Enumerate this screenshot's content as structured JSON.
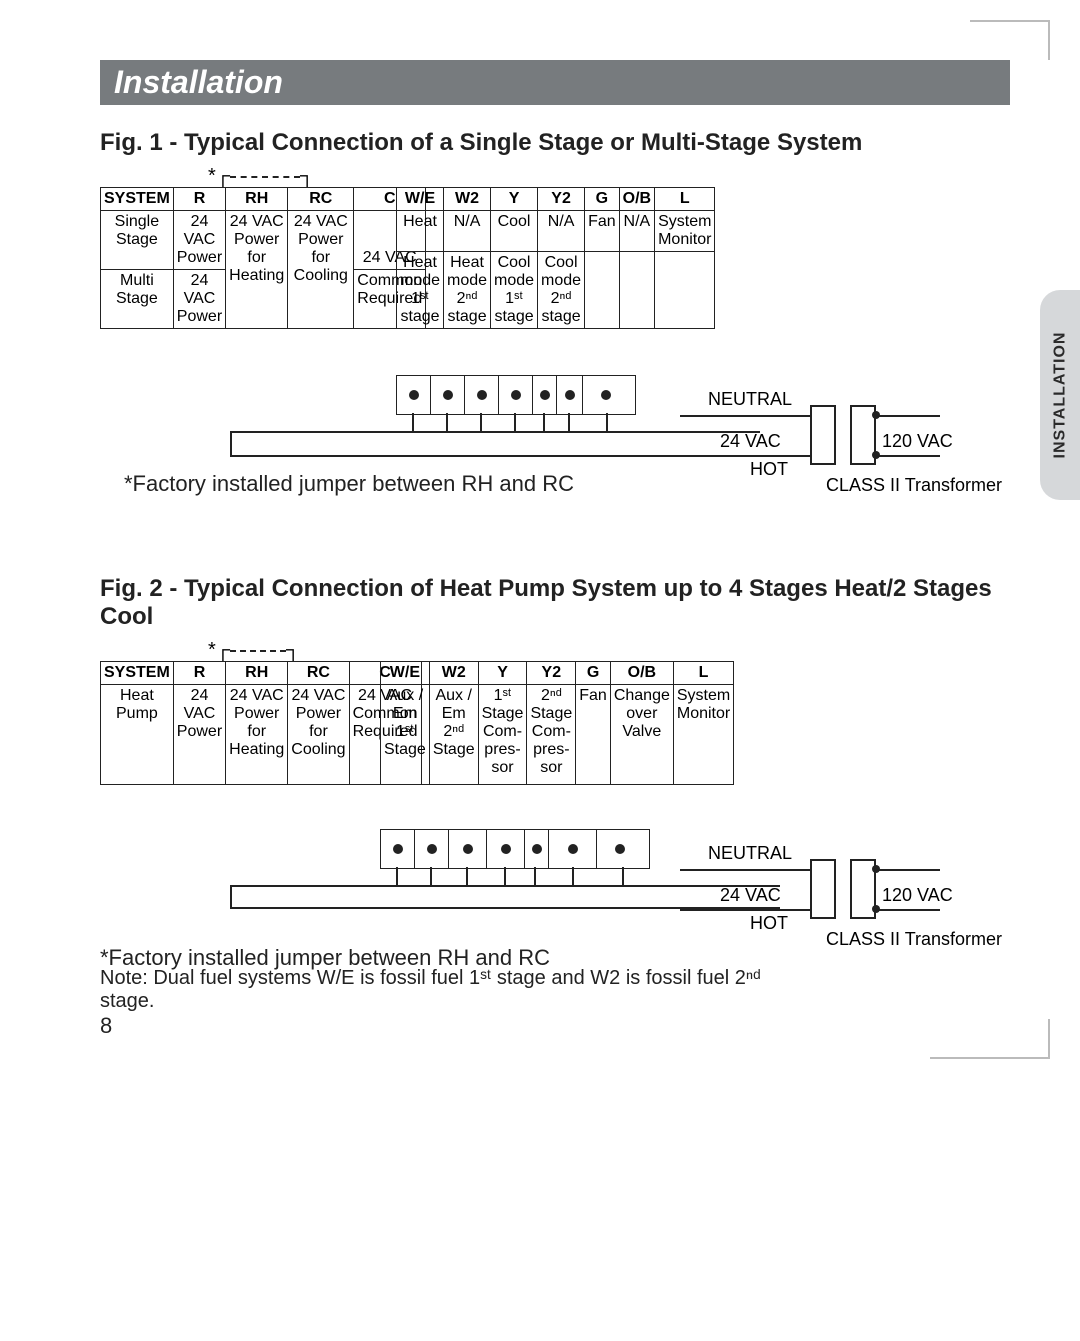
{
  "section_bar": "Installation",
  "side_tab": "INSTALLATION",
  "page_number": "8",
  "fig1": {
    "title": "Fig. 1 - Typical Connection of a Single Stage or Multi-Stage System",
    "footnote": "*Factory installed jumper between RH and RC",
    "left_headers": [
      "SYSTEM",
      "R",
      "RH",
      "RC",
      "C"
    ],
    "right_headers": [
      "W/E",
      "W2",
      "Y",
      "Y2",
      "G",
      "O/B",
      "L"
    ],
    "row1_system": "Single Stage",
    "row2_system": "Multi Stage",
    "r1": "24 VAC Power",
    "rh1": "24 VAC Power for Heating",
    "rc1": "24 VAC Power for Cooling",
    "c1": "24 VAC",
    "r2": "24 VAC Power",
    "rh2": "24 VAC Power",
    "rc2": "24 VAC Power",
    "c2": "Common Required",
    "we1": "Heat",
    "w21": "N/A",
    "y1": "Cool",
    "y21": "N/A",
    "g1": "Fan",
    "ob1": "N/A",
    "l1": "System Monitor",
    "we2": "Heat mode 1ˢᵗ stage",
    "w22": "Heat mode 2ⁿᵈ stage",
    "y2": "Cool mode 1ˢᵗ stage",
    "y22": "Cool mode 2ⁿᵈ stage",
    "tf": {
      "neutral": "NEUTRAL",
      "v24": "24 VAC",
      "hot": "HOT",
      "v120": "120 VAC",
      "label": "CLASS II Transformer"
    }
  },
  "fig2": {
    "title": "Fig. 2 - Typical Connection of Heat Pump System up to 4 Stages Heat/2 Stages Cool",
    "footnote": "*Factory installed jumper between RH and RC",
    "note": "Note: Dual fuel systems W/E is fossil fuel 1ˢᵗ stage and W2 is fossil fuel 2ⁿᵈ stage.",
    "left_headers": [
      "SYSTEM",
      "R",
      "RH",
      "RC",
      "C"
    ],
    "right_headers": [
      "W/E",
      "W2",
      "Y",
      "Y2",
      "G",
      "O/B",
      "L"
    ],
    "row_system": "Heat Pump",
    "r": "24 VAC Power",
    "rh": "24 VAC Power for Heating",
    "rc": "24 VAC Power for Cooling",
    "c": "24 VAC Common Required",
    "we": "Aux / Em 1ˢᵗ Stage",
    "w2": "Aux / Em 2ⁿᵈ Stage",
    "y": "1ˢᵗ Stage Com-pres-sor",
    "y2": "2ⁿᵈ Stage Com-pres-sor",
    "g": "Fan",
    "ob": "Change over Valve",
    "l": "System Monitor",
    "tf": {
      "neutral": "NEUTRAL",
      "v24": "24 VAC",
      "hot": "HOT",
      "v120": "120 VAC",
      "label": "CLASS II Transformer"
    }
  }
}
